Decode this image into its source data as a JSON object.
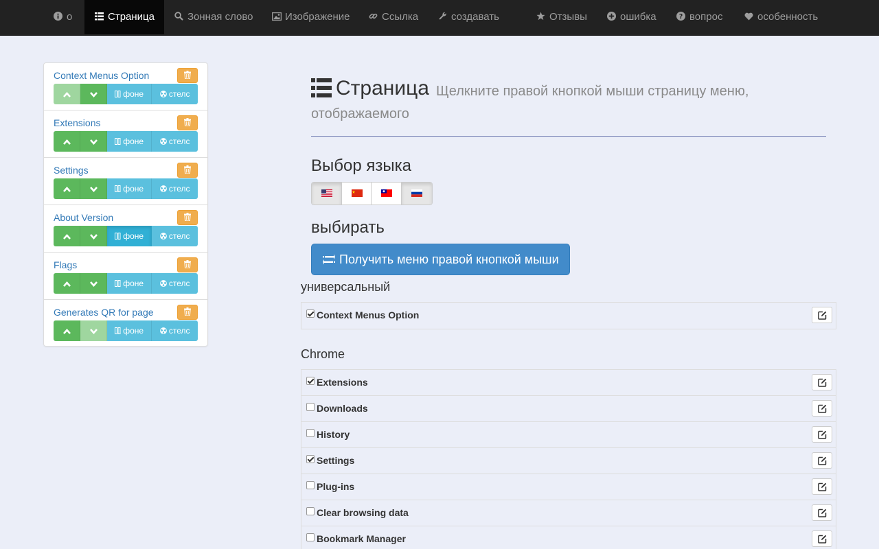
{
  "nav": {
    "items": [
      {
        "icon": "info-icon",
        "label": "о",
        "active": false
      },
      {
        "icon": "list-icon",
        "label": "Страница",
        "active": true
      },
      {
        "icon": "search-icon",
        "label": "Зонная слово",
        "active": false
      },
      {
        "icon": "image-icon",
        "label": "Изображение",
        "active": false
      },
      {
        "icon": "link-icon",
        "label": "Ссылка",
        "active": false
      },
      {
        "icon": "wrench-icon",
        "label": "создавать",
        "active": false
      },
      {
        "icon": "star-icon",
        "label": "Отзывы",
        "active": false
      },
      {
        "icon": "plus-circle-icon",
        "label": "ошибка",
        "active": false
      },
      {
        "icon": "question-icon",
        "label": "вопрос",
        "active": false
      },
      {
        "icon": "heart-icon",
        "label": "особенность",
        "active": false
      }
    ]
  },
  "sidebar": {
    "bg_label": "фоне",
    "stealth_label": "стелс",
    "items": [
      {
        "title": "Context Menus Option",
        "up_disabled": true,
        "down_disabled": false,
        "bg_active": false
      },
      {
        "title": "Extensions",
        "up_disabled": false,
        "down_disabled": false,
        "bg_active": false
      },
      {
        "title": "Settings",
        "up_disabled": false,
        "down_disabled": false,
        "bg_active": false
      },
      {
        "title": "About Version",
        "up_disabled": false,
        "down_disabled": false,
        "bg_active": true
      },
      {
        "title": "Flags",
        "up_disabled": false,
        "down_disabled": false,
        "bg_active": false
      },
      {
        "title": "Generates QR for page",
        "up_disabled": false,
        "down_disabled": true,
        "bg_active": false
      }
    ]
  },
  "header": {
    "title": "Страница",
    "subtitle_line1": "Щелкните правой кнопкой мыши страницу меню,",
    "subtitle_line2": "отображаемого"
  },
  "language": {
    "heading": "Выбор языка",
    "flags": [
      {
        "icon": "us-flag-icon",
        "active": true
      },
      {
        "icon": "cn-flag-icon",
        "active": false
      },
      {
        "icon": "tw-flag-icon",
        "active": false
      },
      {
        "icon": "ru-flag-icon",
        "active": true
      }
    ]
  },
  "choose": {
    "heading": "выбирать",
    "button_label": "Получить меню правой кнопкой мыши"
  },
  "sections": [
    {
      "title": "универсальный",
      "items": [
        {
          "label": "Context Menus Option",
          "checked": true
        }
      ]
    },
    {
      "title": "Chrome",
      "items": [
        {
          "label": "Extensions",
          "checked": true
        },
        {
          "label": "Downloads",
          "checked": false
        },
        {
          "label": "History",
          "checked": false
        },
        {
          "label": "Settings",
          "checked": true
        },
        {
          "label": "Plug-ins",
          "checked": false
        },
        {
          "label": "Clear browsing data",
          "checked": false
        },
        {
          "label": "Bookmark Manager",
          "checked": false
        }
      ]
    }
  ],
  "colors": {
    "navbar": "#222222",
    "primary": "#428bca",
    "success": "#5cb85c",
    "info": "#5bc0de",
    "warning": "#f0ad4e",
    "link": "#337ab7"
  }
}
